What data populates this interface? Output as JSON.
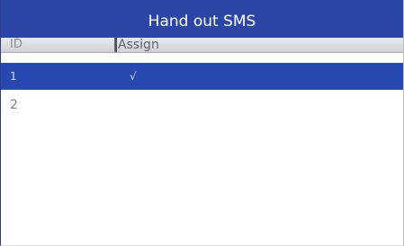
{
  "window": {
    "title": "Hand out SMS"
  },
  "table": {
    "columns": [
      "ID",
      "Assign"
    ],
    "rows": [
      {
        "id": "1",
        "assign": "√",
        "selected": true
      },
      {
        "id": "2",
        "assign": "",
        "selected": false
      }
    ]
  },
  "colors": {
    "title_bar": "#2b46a6",
    "selected_row": "#2848b1",
    "header_background": "#d9dbe0"
  }
}
